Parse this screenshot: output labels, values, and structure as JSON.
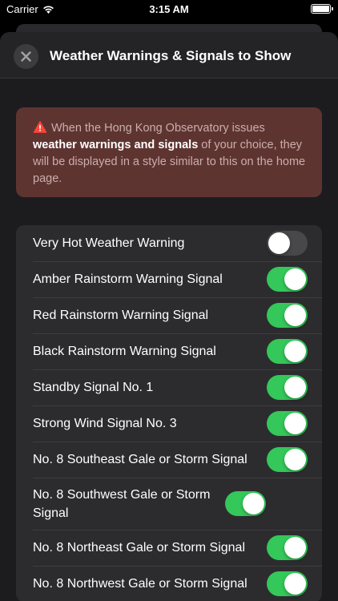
{
  "status_bar": {
    "carrier": "Carrier",
    "time": "3:15 AM"
  },
  "nav": {
    "title": "Weather Warnings & Signals to Show"
  },
  "info": {
    "text_before": "When the Hong Kong Observatory issues",
    "text_bold": "weather warnings and signals",
    "text_after": " of your choice, they will be displayed in a style similar to this on the home page."
  },
  "toggles": [
    {
      "label": "Very Hot Weather Warning",
      "on": false
    },
    {
      "label": "Amber Rainstorm Warning Signal",
      "on": true
    },
    {
      "label": "Red Rainstorm Warning Signal",
      "on": true
    },
    {
      "label": "Black Rainstorm Warning Signal",
      "on": true
    },
    {
      "label": "Standby Signal No. 1",
      "on": true
    },
    {
      "label": "Strong Wind Signal No. 3",
      "on": true
    },
    {
      "label": "No. 8 Southeast Gale or Storm Signal",
      "on": true
    },
    {
      "label": "No. 8 Southwest Gale or Storm Signal",
      "on": true
    },
    {
      "label": "No. 8 Northeast Gale or Storm Signal",
      "on": true
    },
    {
      "label": "No. 8 Northwest Gale or Storm Signal",
      "on": true
    }
  ],
  "colors": {
    "toggle_on": "#34c759",
    "info_background": "#5e3431",
    "warning_icon": "#ff453a"
  }
}
